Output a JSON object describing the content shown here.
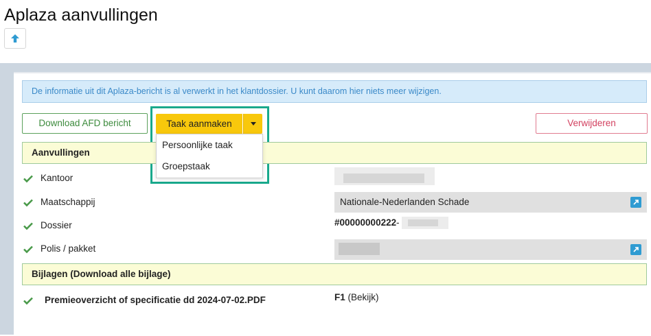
{
  "page": {
    "title": "Aplaza aanvullingen",
    "up_icon": "arrow-up-icon"
  },
  "alert": {
    "text": "De informatie uit dit Aplaza-bericht is al verwerkt in het klantdossier. U kunt daarom hier niets meer wijzigen."
  },
  "toolbar": {
    "download_label": "Download AFD bericht",
    "task_label": "Taak aanmaken",
    "task_menu": [
      "Persoonlijke taak",
      "Groepstaak"
    ],
    "delete_label": "Verwijderen"
  },
  "aanvullingen": {
    "heading": "Aanvullingen",
    "rows": [
      {
        "label": "Kantoor",
        "value": ""
      },
      {
        "label": "Maatschappij",
        "value": "Nationale-Nederlanden Schade"
      },
      {
        "label": "Dossier",
        "value": "#00000000222",
        "suffix": "-"
      },
      {
        "label": "Polis / pakket",
        "value": ""
      }
    ]
  },
  "bijlagen": {
    "heading": "Bijlagen (Download alle bijlage)",
    "items": [
      {
        "name": "Premieoverzicht of specificatie dd 2024-07-02.PDF",
        "code": "F1",
        "action": "(Bekijk)"
      }
    ]
  },
  "colors": {
    "alert_bg": "#d6ebfa",
    "accent_yellow": "#f8c80c",
    "success_green": "#3d8b3d",
    "danger_pink": "#d2405f",
    "highlight_teal": "#19a98c",
    "link_blue": "#2f9bd2"
  }
}
